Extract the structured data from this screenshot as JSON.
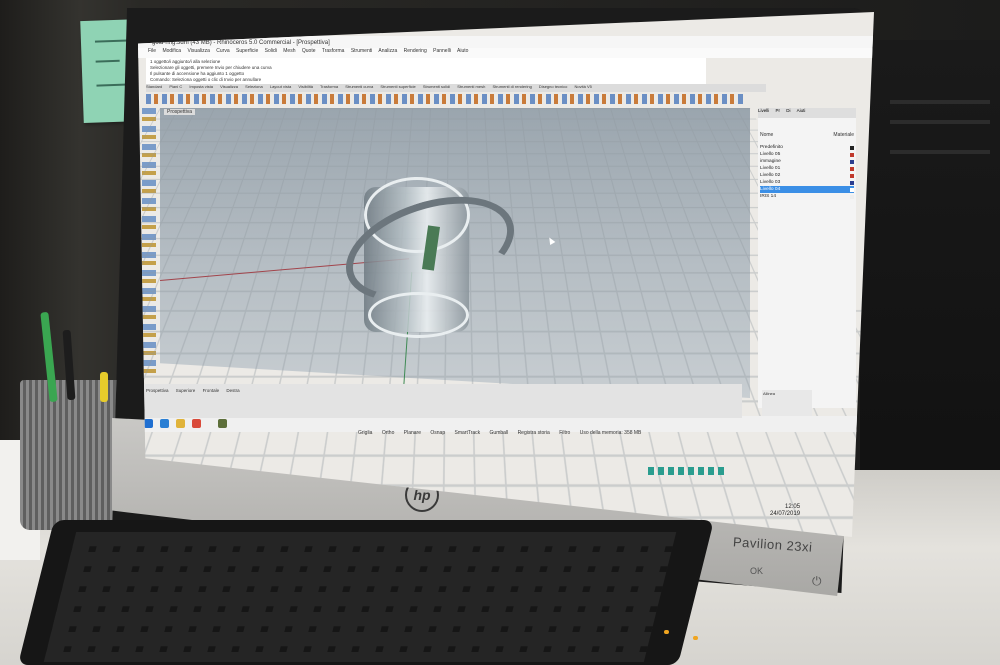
{
  "scene": {
    "description_kind": "photo-of-monitor",
    "accent_colors": {
      "selected_layer": "#3b8fe6",
      "x_axis": "#a2444b",
      "y_axis": "#3f8a55",
      "sticky_note": "#8fd3b4"
    }
  },
  "monitor": {
    "brand_logo": "hp",
    "model": "Pavilion 23xi",
    "ok_label": "OK",
    "power_icon": "power-icon"
  },
  "app": {
    "window_title": "gold-ring.3dm (43 MB) - Rhinoceros 5.0 Commercial - [Prospettiva]",
    "menu": [
      "File",
      "Modifica",
      "Visualizza",
      "Curva",
      "Superficie",
      "Solidi",
      "Mesh",
      "Quote",
      "Trasforma",
      "Strumenti",
      "Analizza",
      "Rendering",
      "Pannelli",
      "Aiuto"
    ],
    "command_log": [
      "1 oggetto/i aggiunto/i alla selezione",
      "Selezionare gli oggetti, premere Invio per chiudere una curva",
      "Il pulsante di accensione ha aggiunto 1 oggetto",
      "Comando: Seleziona oggetti o clic di Invio per annullare"
    ],
    "tabs": [
      "Standard",
      "Piani C",
      "Imposta vista",
      "Visualizza",
      "Seleziona",
      "Layout vista",
      "Visibilità",
      "Trasforma",
      "Strumenti curva",
      "Strumenti superficie",
      "Strumenti solidi",
      "Strumenti mesh",
      "Strumenti di rendering",
      "Disegno tecnico",
      "Novità V5"
    ],
    "viewport_label": "Prospettiva",
    "right_panel": {
      "tabs": [
        "Livelli",
        "Pr",
        "Di",
        "Aiuti"
      ],
      "header_name": "Nome",
      "header_material": "Materiale",
      "layers": [
        {
          "name": "Predefinito",
          "color": "#222222",
          "selected": false
        },
        {
          "name": "Livello 05",
          "color": "#c0392b",
          "selected": false
        },
        {
          "name": "immagine",
          "color": "#2c3e8f",
          "selected": false
        },
        {
          "name": "Livello 01",
          "color": "#c0392b",
          "selected": false
        },
        {
          "name": "Livello 02",
          "color": "#c0392b",
          "selected": false
        },
        {
          "name": "Livello 03",
          "color": "#2c3e8f",
          "selected": false
        },
        {
          "name": "Livello 04",
          "color": "#ffffff",
          "selected": true
        },
        {
          "name": "IRIS 14",
          "color": "#eeeeee",
          "selected": false
        }
      ],
      "allinea_label": "Allinea"
    },
    "bottom_tabs": [
      "Prospettiva",
      "Superiore",
      "Frontale",
      "Destra"
    ],
    "status": [
      "Griglia",
      "Ortho",
      "Planare",
      "Osnap",
      "SmartTrack",
      "Gumball",
      "Registra storia",
      "Filtro",
      "Uso della memoria: 358 MB"
    ],
    "clock": {
      "time": "12:05",
      "date": "24/07/2019"
    }
  }
}
